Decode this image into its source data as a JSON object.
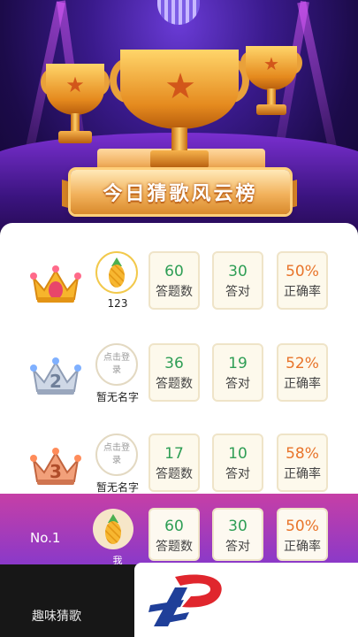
{
  "banner": {
    "title": "今日猜歌风云榜"
  },
  "labels": {
    "questions": "答题数",
    "correct": "答对",
    "accuracy": "正确率"
  },
  "leaderboard": [
    {
      "rank": 1,
      "name": "123",
      "avatar": "pineapple",
      "questions": "60",
      "correct": "30",
      "accuracy": "50%"
    },
    {
      "rank": 2,
      "name": "暂无名字",
      "avatar_text": "点击登录",
      "questions": "36",
      "correct": "19",
      "accuracy": "52%"
    },
    {
      "rank": 3,
      "name": "暂无名字",
      "avatar_text": "点击登录",
      "questions": "17",
      "correct": "10",
      "accuracy": "58%"
    }
  ],
  "me": {
    "rank_label": "No.1",
    "name": "我",
    "questions": "60",
    "correct": "30",
    "accuracy": "50%"
  },
  "bottom": {
    "tab": "趣味猜歌"
  },
  "colors": {
    "accent_green": "#2e9e55",
    "accent_orange": "#e8742a",
    "banner_purple": "#3a1a8c",
    "me_row": "#c63fa6"
  },
  "icons": [
    "trophy-icon",
    "gold-crown-icon",
    "silver-crown-icon",
    "bronze-crown-icon",
    "pineapple-avatar-icon",
    "brand-logo-icon"
  ]
}
